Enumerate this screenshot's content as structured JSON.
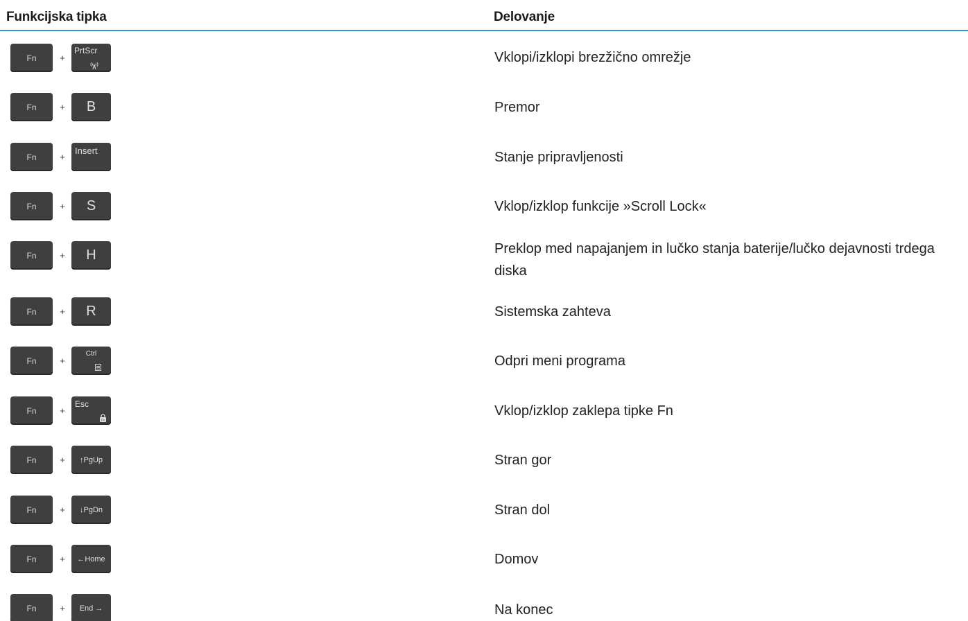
{
  "table": {
    "header": {
      "col1": "Funkcijska tipka",
      "col2": "Delovanje"
    },
    "rows": [
      {
        "fn": "Fn",
        "plus": "+",
        "key": "PrtScr",
        "key_icon": "wireless-icon",
        "desc": "Vklopi/izklopi brezžično omrežje"
      },
      {
        "fn": "Fn",
        "plus": "+",
        "key": "B",
        "desc": "Premor"
      },
      {
        "fn": "Fn",
        "plus": "+",
        "key": "Insert",
        "desc": "Stanje pripravljenosti"
      },
      {
        "fn": "Fn",
        "plus": "+",
        "key": "S",
        "desc": "Vklop/izklop funkcije »Scroll Lock«"
      },
      {
        "fn": "Fn",
        "plus": "+",
        "key": "H",
        "desc": "Preklop med napajanjem in lučko stanja baterije/lučko dejavnosti trdega diska"
      },
      {
        "fn": "Fn",
        "plus": "+",
        "key": "R",
        "desc": "Sistemska zahteva"
      },
      {
        "fn": "Fn",
        "plus": "+",
        "key": "Ctrl",
        "key_icon": "menu-icon",
        "desc": "Odpri meni programa"
      },
      {
        "fn": "Fn",
        "plus": "+",
        "key": "Esc",
        "key_icon": "fn-lock-icon",
        "desc": "Vklop/izklop zaklepa tipke Fn"
      },
      {
        "fn": "Fn",
        "plus": "+",
        "key": "↑PgUp",
        "desc": "Stran gor"
      },
      {
        "fn": "Fn",
        "plus": "+",
        "key": "↓PgDn",
        "desc": "Stran dol"
      },
      {
        "fn": "Fn",
        "plus": "+",
        "key": "←Home",
        "desc": "Domov"
      },
      {
        "fn": "Fn",
        "plus": "+",
        "key": "End →",
        "desc": "Na konec"
      }
    ]
  }
}
